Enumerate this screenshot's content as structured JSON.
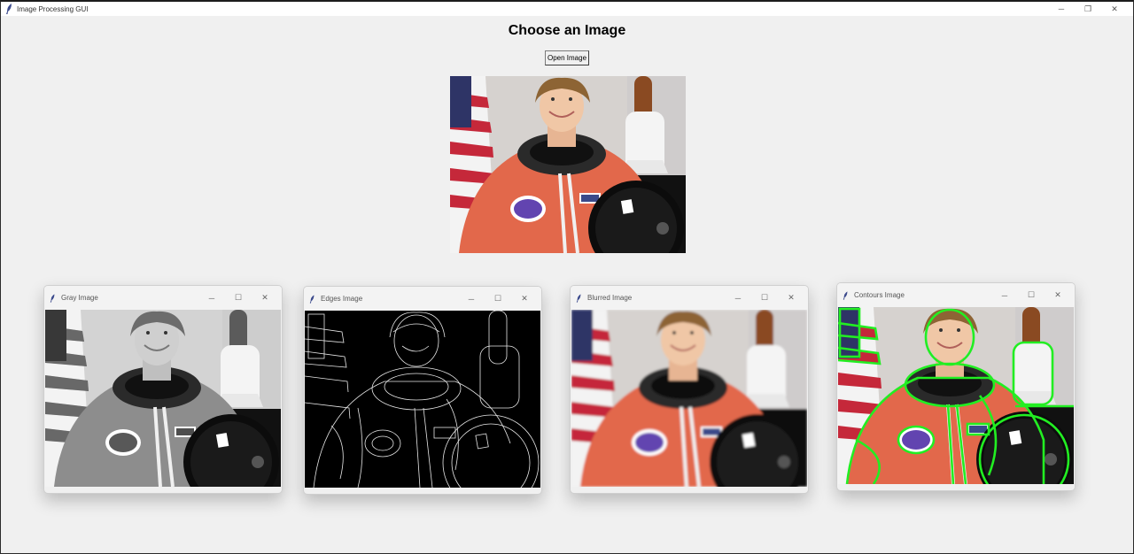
{
  "app": {
    "title": "Image Processing GUI",
    "icon": "feather-icon"
  },
  "window_controls": {
    "minimize": "─",
    "maximize": "❐",
    "close": "✕"
  },
  "heading": "Choose an Image",
  "open_button": "Open Image",
  "sub_window_controls": {
    "minimize": "─",
    "maximize": "☐",
    "close": "✕"
  },
  "sub_windows": [
    {
      "title": "Gray Image",
      "filter": "grayscale"
    },
    {
      "title": "Edges Image",
      "filter": "edges"
    },
    {
      "title": "Blurred Image",
      "filter": "blur"
    },
    {
      "title": "Contours Image",
      "filter": "contours"
    }
  ],
  "colors": {
    "background": "#f0f0f0",
    "contour_green": "#22ee22",
    "suit_orange": "#e0664a"
  }
}
